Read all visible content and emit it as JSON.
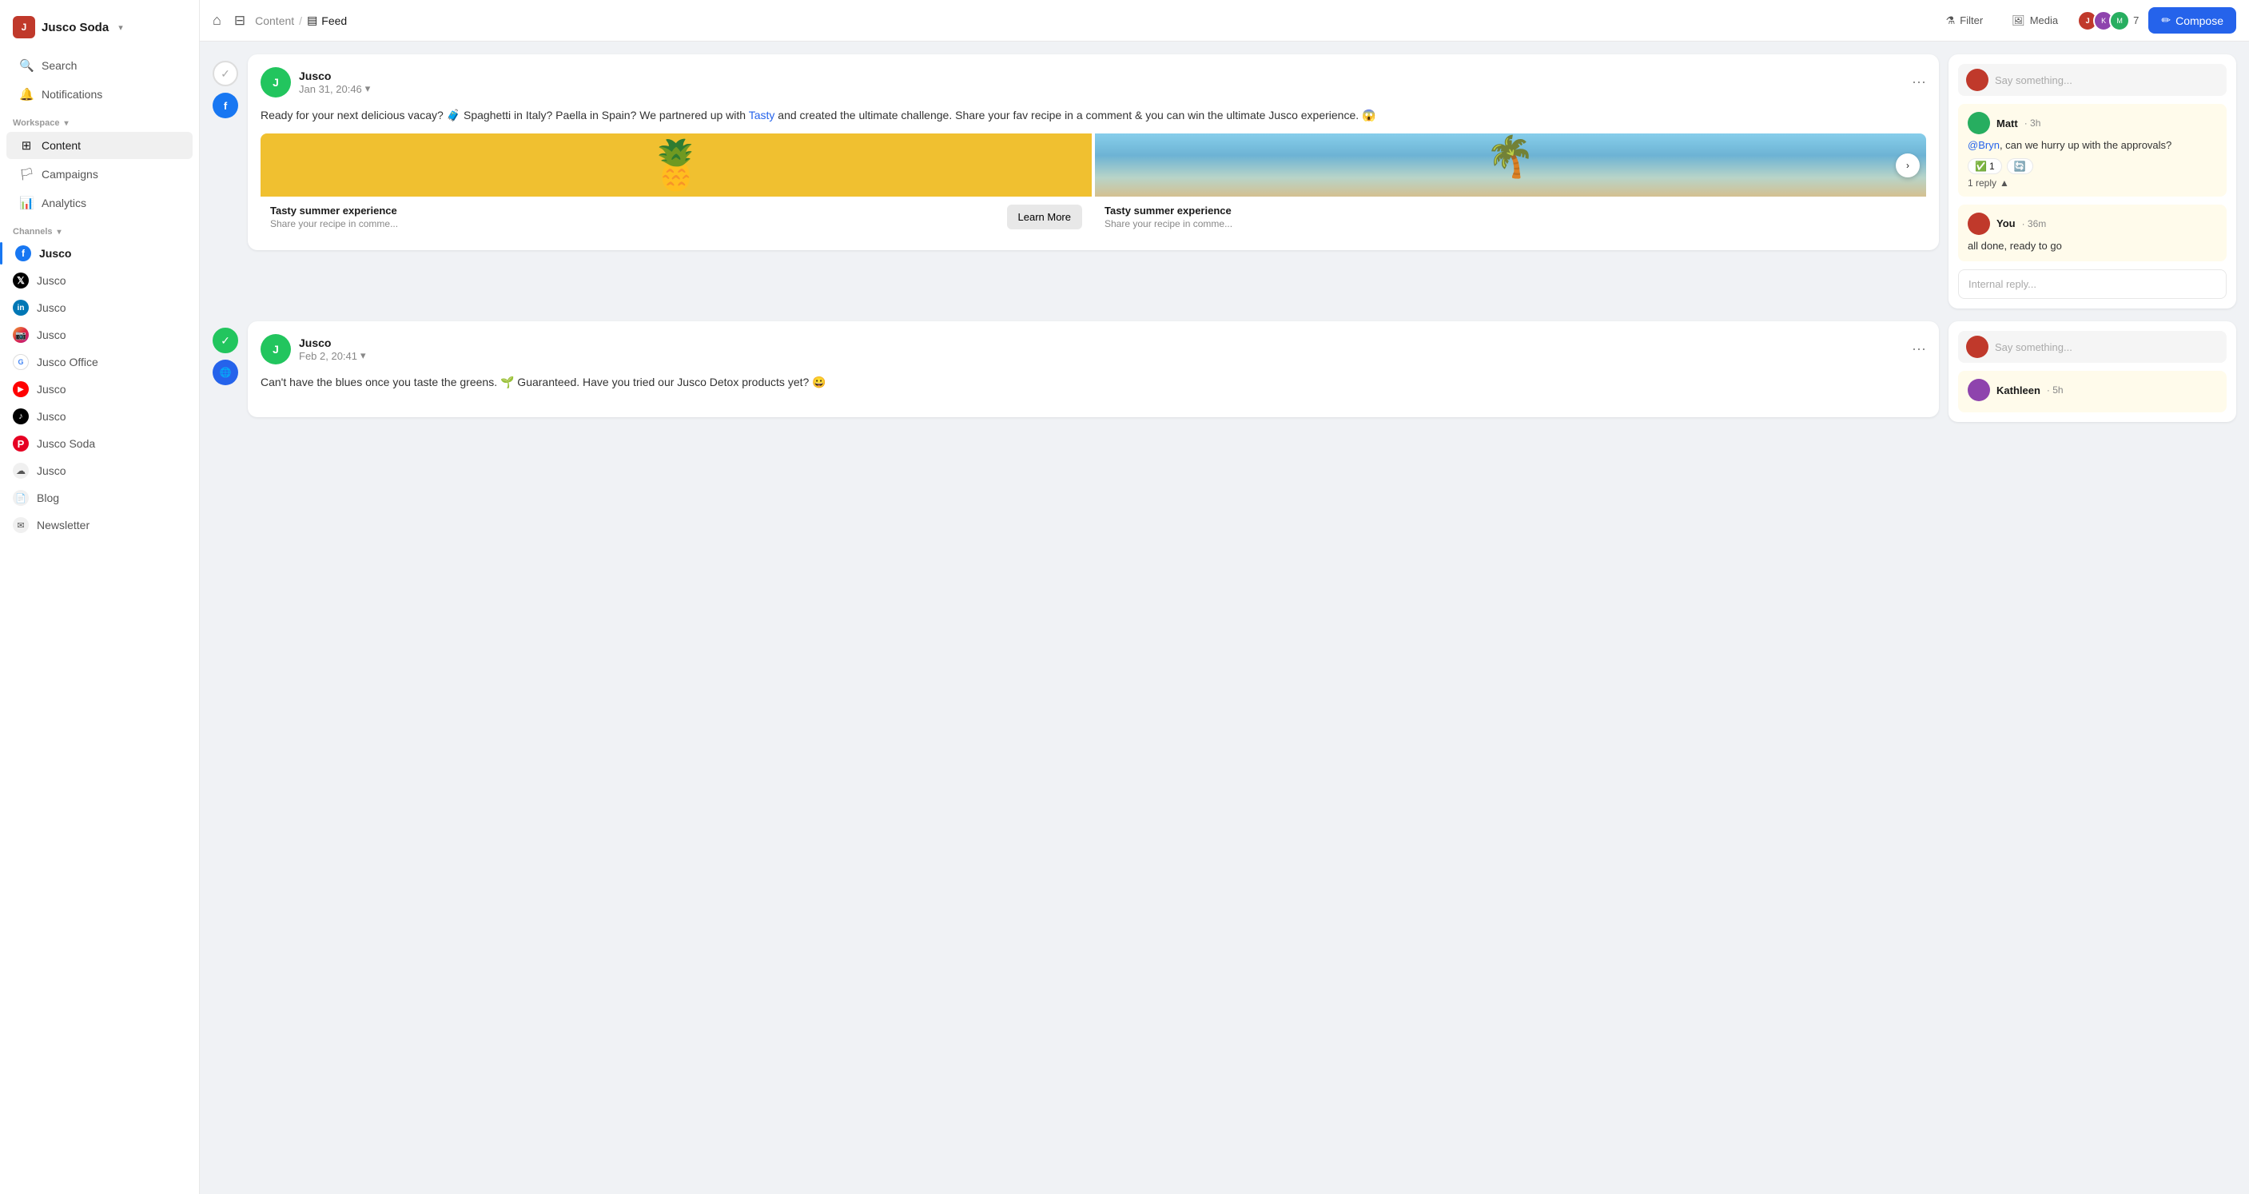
{
  "brand": {
    "name": "Jusco Soda",
    "logo_initials": "J"
  },
  "sidebar": {
    "search_label": "Search",
    "notifications_label": "Notifications",
    "workspace_label": "Workspace",
    "workspace_items": [
      {
        "id": "content",
        "label": "Content",
        "icon": "grid"
      },
      {
        "id": "campaigns",
        "label": "Campaigns",
        "icon": "flag"
      },
      {
        "id": "analytics",
        "label": "Analytics",
        "icon": "bar-chart"
      }
    ],
    "channels_label": "Channels",
    "channels": [
      {
        "id": "facebook",
        "label": "Jusco",
        "platform": "facebook"
      },
      {
        "id": "x",
        "label": "Jusco",
        "platform": "x"
      },
      {
        "id": "linkedin",
        "label": "Jusco",
        "platform": "linkedin"
      },
      {
        "id": "instagram",
        "label": "Jusco",
        "platform": "instagram"
      },
      {
        "id": "google",
        "label": "Jusco Office",
        "platform": "google"
      },
      {
        "id": "youtube",
        "label": "Jusco",
        "platform": "youtube"
      },
      {
        "id": "tiktok",
        "label": "Jusco",
        "platform": "tiktok"
      },
      {
        "id": "pinterest",
        "label": "Jusco Soda",
        "platform": "pinterest"
      },
      {
        "id": "generic",
        "label": "Jusco",
        "platform": "generic"
      },
      {
        "id": "blog",
        "label": "Blog",
        "platform": "blog"
      },
      {
        "id": "newsletter",
        "label": "Newsletter",
        "platform": "newsletter"
      }
    ]
  },
  "topbar": {
    "breadcrumb_parent": "Content",
    "breadcrumb_current": "Feed",
    "filter_label": "Filter",
    "media_label": "Media",
    "member_count": "7",
    "compose_label": "Compose"
  },
  "posts": [
    {
      "id": "post1",
      "author": "Jusco",
      "date": "Jan 31, 20:46",
      "approved": false,
      "platform": "facebook",
      "text": "Ready for your next delicious vacay? 🧳 Spaghetti in Italy? Paella in Spain? We partnered up with Tasty and created the ultimate challenge. Share your fav recipe in a comment & you can win the ultimate Jusco experience. 😱",
      "link_text": "Tasty",
      "card1_title": "Tasty summer experience",
      "card1_subtitle": "Share your recipe in comme...",
      "card2_title": "Tasty summer experience",
      "card2_subtitle": "Share your recipe in comme...",
      "learn_more_label": "Learn More",
      "comments": [
        {
          "id": "c1",
          "author": "Matt",
          "time": "3h",
          "text": "@Bryn, can we hurry up with the approvals?",
          "mention": "@Bryn",
          "reactions": [
            {
              "emoji": "✅",
              "count": "1"
            }
          ],
          "reply_count": "1 reply"
        },
        {
          "id": "c2",
          "author": "You",
          "time": "36m",
          "text": "all done, ready to go",
          "reactions": [],
          "reply_count": null
        }
      ],
      "comment_placeholder": "Say something...",
      "internal_reply_placeholder": "Internal reply..."
    },
    {
      "id": "post2",
      "author": "Jusco",
      "date": "Feb 2, 20:41",
      "approved": true,
      "platform": "globe",
      "text": "Can't have the blues once you taste the greens. 🌱 Guaranteed. Have you tried our Jusco Detox products yet? 😀",
      "comment_placeholder": "Say something...",
      "comments2": [
        {
          "id": "k1",
          "author": "Kathleen",
          "time": "5h",
          "text": ""
        }
      ]
    }
  ]
}
